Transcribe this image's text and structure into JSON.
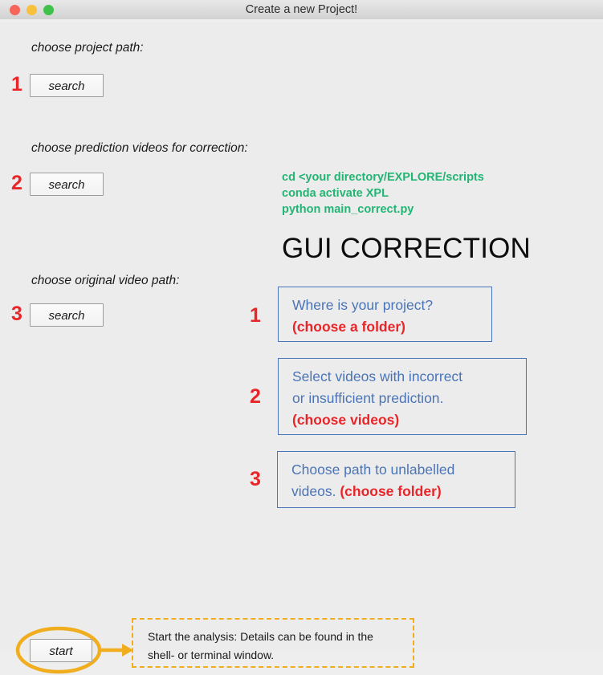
{
  "window": {
    "title": "Create a new Project!",
    "traffic_lights": [
      "close-button",
      "minimize-button",
      "zoom-button"
    ],
    "background_color": "#ececec"
  },
  "colors": {
    "accent_red": "#e8262a",
    "callout_blue": "#4a74b8",
    "callout_border_blue": "#4a72bd",
    "terminal_green": "#22b573",
    "highlight_orange": "#f0ad1e"
  },
  "form": {
    "fields": [
      {
        "number": "1",
        "label": "choose project path:",
        "button_label": "search"
      },
      {
        "number": "2",
        "label": "choose prediction videos for correction:",
        "button_label": "search"
      },
      {
        "number": "3",
        "label": "choose original video path:",
        "button_label": "search"
      }
    ],
    "start_button_label": "start"
  },
  "terminal": {
    "commands": [
      "cd <your directory/EXPLORE/scripts",
      "conda activate XPL",
      "python main_correct.py"
    ]
  },
  "heading": "GUI CORRECTION",
  "callouts": [
    {
      "number": "1",
      "line1": "Where is your project?",
      "line2": "(choose a folder)"
    },
    {
      "number": "2",
      "line1": "Select videos with incorrect",
      "line2": "or insufficient prediction.",
      "line3": "(choose videos)"
    },
    {
      "number": "3",
      "line1": "Choose path to unlabelled",
      "line2_prefix": "videos. ",
      "line2_accent": "(choose folder)"
    }
  ],
  "note": {
    "line1": "Start the analysis: Details can be found in the",
    "line2": "shell- or terminal window."
  }
}
